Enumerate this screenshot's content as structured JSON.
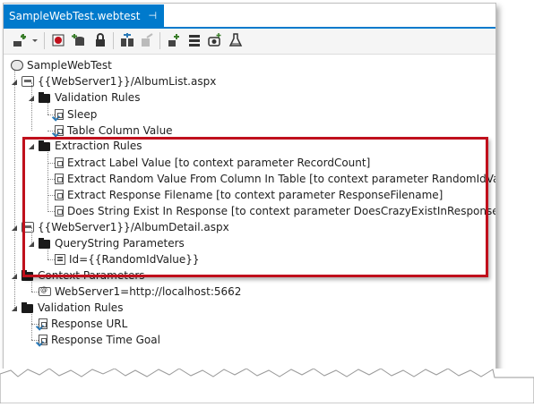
{
  "tab": {
    "title": "SampleWebTest.webtest",
    "pin_glyph": "⊣",
    "close_glyph": "✕"
  },
  "toolbar": {
    "icons": [
      "add-request-icon",
      "dropdown-arrow-icon",
      "record-icon",
      "add-datasource-icon",
      "credentials-icon",
      "parameterize-icon",
      "promote-icon",
      "add-plugin-icon",
      "settings-icon",
      "add-recording-icon",
      "run-icon"
    ]
  },
  "tree": {
    "root": "SampleWebTest",
    "request1": "{{WebServer1}}/AlbumList.aspx",
    "validation_rules": "Validation Rules",
    "sleep": "Sleep",
    "table_column_value": "Table Column Value",
    "extraction_rules": "Extraction Rules",
    "extract_label": "Extract Label Value [to context parameter RecordCount]",
    "extract_random": "Extract Random Value From Column In Table [to context parameter RandomIdValue]",
    "extract_response_filename": "Extract Response Filename [to context parameter ResponseFilename]",
    "does_string_exist": "Does String Exist In Response [to context parameter DoesCrazyExistInResponse]",
    "request2": "{{WebServer1}}/AlbumDetail.aspx",
    "querystring_parameters": "QueryString Parameters",
    "qs_id": "Id={{RandomIdValue}}",
    "context_parameters": "Context Parameters",
    "webserver1": "WebServer1=http://localhost:5662",
    "validation_rules_global": "Validation Rules",
    "response_url": "Response URL",
    "response_time_goal": "Response Time Goal"
  },
  "colors": {
    "accent": "#007acc",
    "highlight": "#c0101c"
  }
}
